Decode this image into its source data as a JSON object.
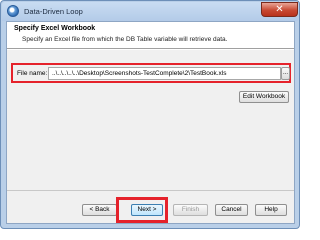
{
  "window": {
    "title": "Data-Driven Loop",
    "close_label": "✕"
  },
  "header": {
    "title": "Specify Excel Workbook",
    "subtitle": "Specify an Excel file from which the DB Table variable will retrieve data."
  },
  "file": {
    "label": "File name:",
    "value": "..\\..\\..\\..\\..\\Desktop\\Screenshots-TestComplete\\2\\TestBook.xls",
    "browse_label": "..."
  },
  "edit_workbook_label": "Edit Workbook",
  "footer": {
    "back_label": "< Back",
    "next_label": "Next >",
    "finish_label": "Finish",
    "cancel_label": "Cancel",
    "help_label": "Help"
  },
  "colors": {
    "highlight": "#e5222b",
    "title_bar": "#b9cfe8"
  }
}
